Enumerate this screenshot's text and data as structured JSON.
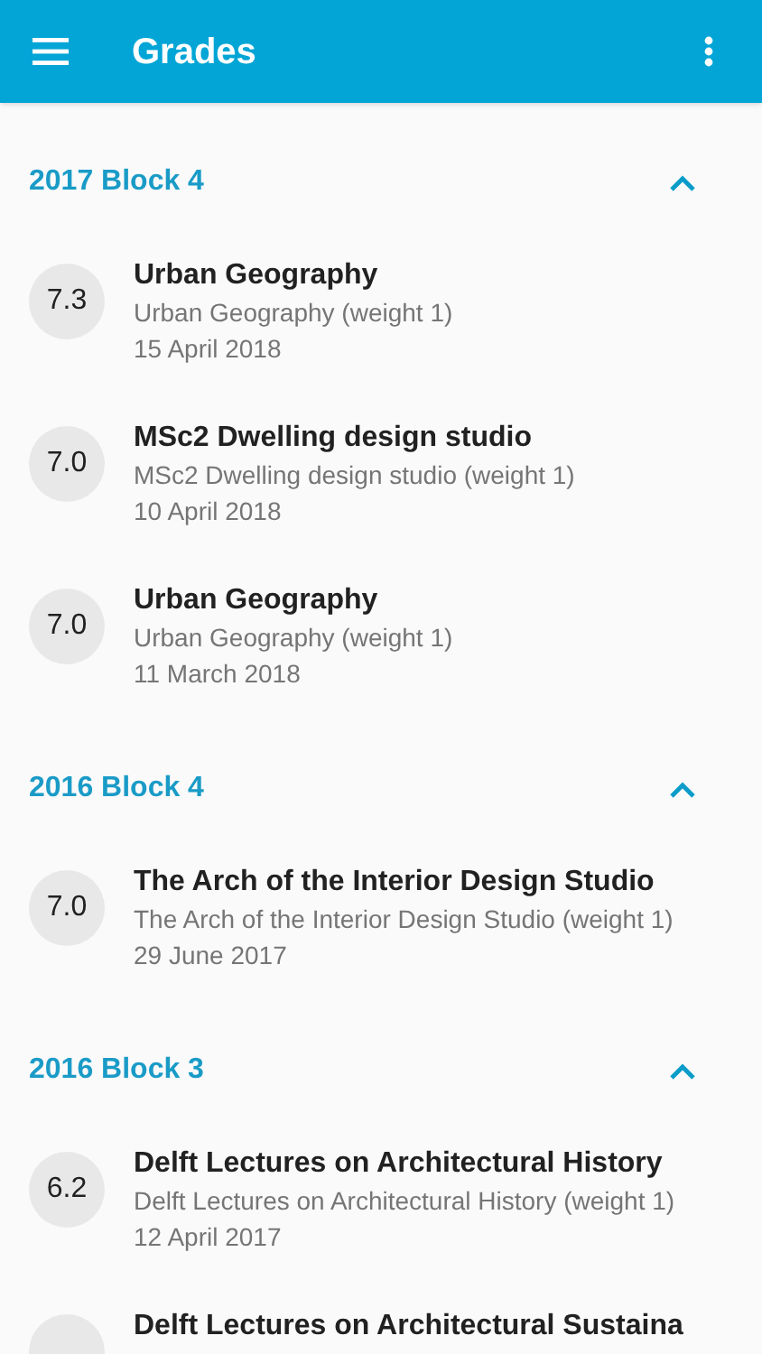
{
  "app_bar": {
    "title": "Grades"
  },
  "sections": [
    {
      "title": "2017 Block 4",
      "expanded": true,
      "items": [
        {
          "grade": "7.3",
          "title": "Urban Geography",
          "subtitle": "Urban Geography (weight 1)",
          "date": "15 April 2018"
        },
        {
          "grade": "7.0",
          "title": "MSc2 Dwelling design studio",
          "subtitle": "MSc2 Dwelling design studio (weight 1)",
          "date": "10 April 2018"
        },
        {
          "grade": "7.0",
          "title": "Urban Geography",
          "subtitle": "Urban Geography (weight 1)",
          "date": "11 March 2018"
        }
      ]
    },
    {
      "title": "2016 Block 4",
      "expanded": true,
      "items": [
        {
          "grade": "7.0",
          "title": "The Arch of the Interior Design Studio",
          "subtitle": "The Arch of the Interior Design Studio (weight 1)",
          "date": "29 June 2017"
        }
      ]
    },
    {
      "title": "2016 Block 3",
      "expanded": true,
      "items": [
        {
          "grade": "6.2",
          "title": "Delft Lectures on Architectural History",
          "subtitle": "Delft Lectures on Architectural History (weight 1)",
          "date": "12 April 2017"
        },
        {
          "title": "Delft Lectures on Architectural Sustaina"
        }
      ]
    }
  ]
}
